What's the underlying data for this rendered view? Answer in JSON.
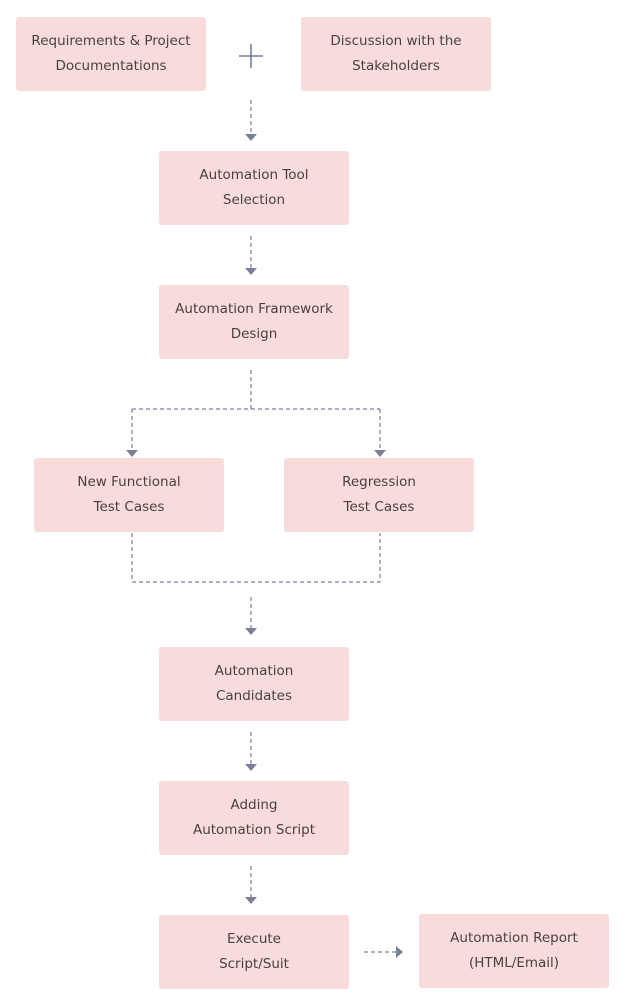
{
  "colors": {
    "box_fill": "#f8dcdc",
    "text": "#4a3f3f",
    "connector": "#7a8196"
  },
  "nodes": [
    {
      "id": "requirements",
      "lines": [
        "Requirements & Project",
        "Documentations"
      ]
    },
    {
      "id": "discussion",
      "lines": [
        "Discussion with the",
        "Stakeholders"
      ]
    },
    {
      "id": "tool-selection",
      "lines": [
        "Automation Tool",
        "Selection"
      ]
    },
    {
      "id": "framework-design",
      "lines": [
        "Automation Framework",
        "Design"
      ]
    },
    {
      "id": "new-functional",
      "lines": [
        "New Functional",
        "Test Cases"
      ]
    },
    {
      "id": "regression",
      "lines": [
        "Regression",
        "Test Cases"
      ]
    },
    {
      "id": "candidates",
      "lines": [
        "Automation",
        "Candidates"
      ]
    },
    {
      "id": "adding-script",
      "lines": [
        "Adding",
        "Automation Script"
      ]
    },
    {
      "id": "execute",
      "lines": [
        "Execute",
        "Script/Suit"
      ]
    },
    {
      "id": "report",
      "lines": [
        "Automation Report",
        "(HTML/Email)"
      ]
    }
  ],
  "edges": [
    {
      "from": [
        "requirements",
        "discussion"
      ],
      "to": "tool-selection",
      "style": "dashed"
    },
    {
      "from": "tool-selection",
      "to": "framework-design",
      "style": "dashed"
    },
    {
      "from": "framework-design",
      "to": [
        "new-functional",
        "regression"
      ],
      "style": "dashed"
    },
    {
      "from": [
        "new-functional",
        "regression"
      ],
      "to": "candidates",
      "style": "dashed"
    },
    {
      "from": "candidates",
      "to": "adding-script",
      "style": "dashed"
    },
    {
      "from": "adding-script",
      "to": "execute",
      "style": "dashed"
    },
    {
      "from": "execute",
      "to": "report",
      "style": "dashed"
    }
  ],
  "icons": {
    "combine": "plus-icon"
  }
}
